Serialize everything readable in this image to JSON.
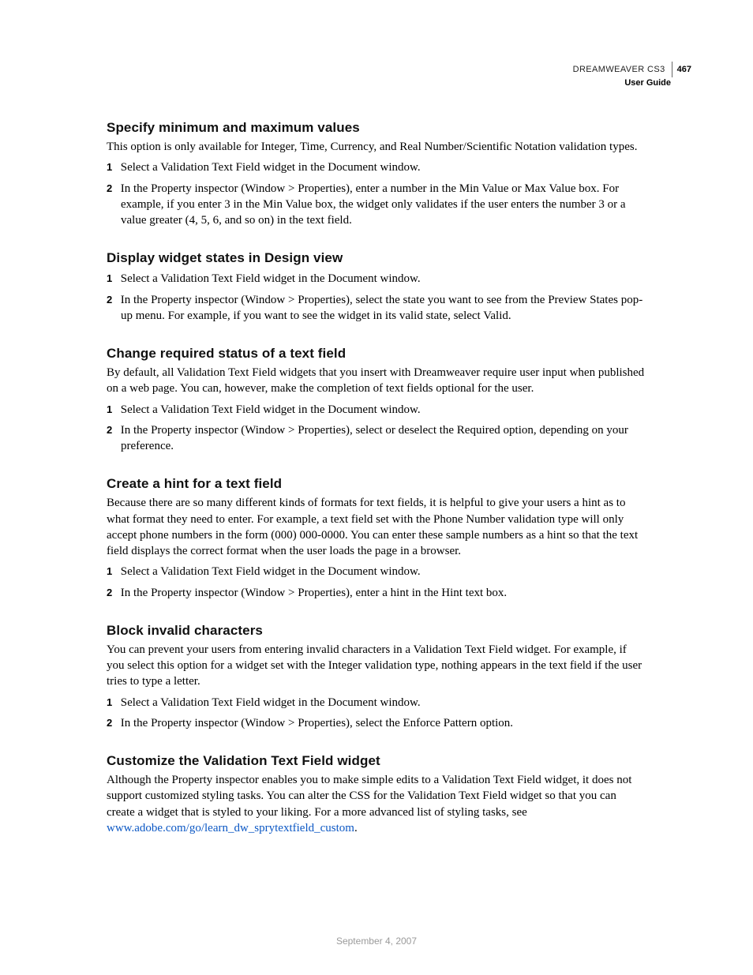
{
  "header": {
    "product": "DREAMWEAVER CS3",
    "page_number": "467",
    "guide": "User Guide"
  },
  "sections": [
    {
      "title": "Specify minimum and maximum values",
      "intro": "This option is only available for Integer, Time, Currency, and Real Number/Scientific Notation validation types.",
      "steps": [
        "Select a Validation Text Field widget in the Document window.",
        "In the Property inspector (Window > Properties), enter a number in the Min Value or Max Value box. For example, if you enter 3 in the Min Value box, the widget only validates if the user enters the number 3 or a value greater (4, 5, 6, and so on) in the text field."
      ]
    },
    {
      "title": "Display widget states in Design view",
      "intro": "",
      "steps": [
        "Select a Validation Text Field widget in the Document window.",
        "In the Property inspector (Window > Properties), select the state you want to see from the Preview States pop-up menu. For example, if you want to see the widget in its valid state, select Valid."
      ]
    },
    {
      "title": "Change required status of a text field",
      "intro": "By default, all Validation Text Field widgets that you insert with Dreamweaver require user input when published on a web page. You can, however, make the completion of text fields optional for the user.",
      "steps": [
        "Select a Validation Text Field widget in the Document window.",
        "In the Property inspector (Window > Properties), select or deselect the Required option, depending on your preference."
      ]
    },
    {
      "title": "Create a hint for a text field",
      "intro": "Because there are so many different kinds of formats for text fields, it is helpful to give your users a hint as to what format they need to enter. For example, a text field set with the Phone Number validation type will only accept phone numbers in the form (000) 000-0000. You can enter these sample numbers as a hint so that the text field displays the correct format when the user loads the page in a browser.",
      "steps": [
        "Select a Validation Text Field widget in the Document window.",
        "In the Property inspector (Window > Properties), enter a hint in the Hint text box."
      ]
    },
    {
      "title": "Block invalid characters",
      "intro": "You can prevent your users from entering invalid characters in a Validation Text Field widget. For example, if you select this option for a widget set with the Integer validation type, nothing appears in the text field if the user tries to type a letter.",
      "steps": [
        "Select a Validation Text Field widget in the Document window.",
        "In the Property inspector (Window > Properties), select the Enforce Pattern option."
      ]
    },
    {
      "title": "Customize the Validation Text Field widget",
      "intro_with_link": {
        "before": "Although the Property inspector enables you to make simple edits to a Validation Text Field widget, it does not support customized styling tasks. You can alter the CSS for the Validation Text Field widget so that you can create a widget that is styled to your liking. For a more advanced list of styling tasks, see ",
        "link_text": "www.adobe.com/go/learn_dw_sprytextfield_custom",
        "after": "."
      },
      "steps": []
    }
  ],
  "footer_date": "September 4, 2007"
}
